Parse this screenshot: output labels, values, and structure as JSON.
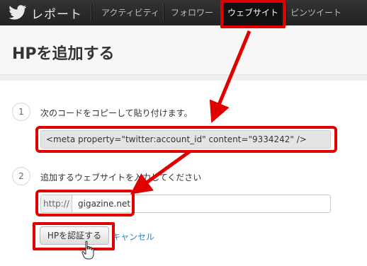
{
  "brand": {
    "label": "レポート",
    "icon": "twitter-bird-icon"
  },
  "nav": {
    "items": [
      {
        "label": "アクティビティ"
      },
      {
        "label": "フォロワー"
      },
      {
        "label": "ウェブサイト",
        "active": true
      },
      {
        "label": "ピンツイート"
      }
    ]
  },
  "page": {
    "title": "HPを追加する"
  },
  "steps": [
    {
      "number": "1",
      "text": "次のコードをコピーして貼り付けます。"
    },
    {
      "number": "2",
      "text": "追加するウェブサイトを入力してください"
    }
  ],
  "code_snippet": "<meta property=\"twitter:account_id\" content=\"9334242\" />",
  "url_field": {
    "prefix": "http://",
    "value": "gigazine.net"
  },
  "actions": {
    "verify_label": "HPを認証する",
    "cancel_label": "キャンセル"
  },
  "colors": {
    "highlight": "#e00000",
    "link": "#2a85c5",
    "nav_bg": "#222222"
  }
}
